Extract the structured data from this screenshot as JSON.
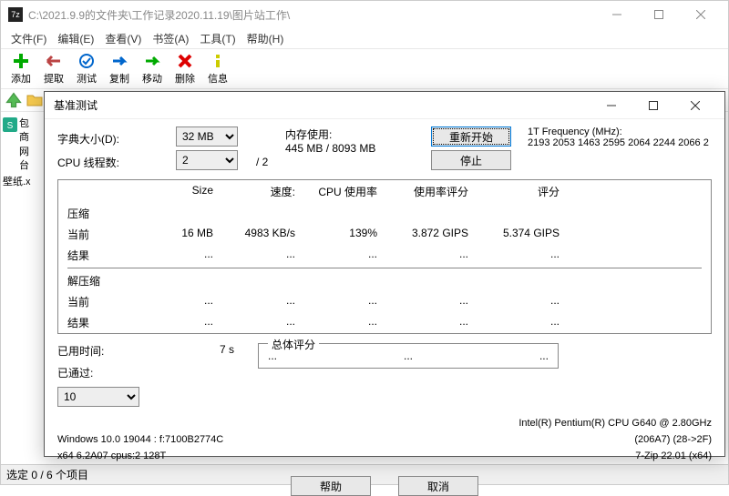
{
  "main": {
    "app_icon_text": "7z",
    "title": "C:\\2021.9.9的文件夹\\工作记录2020.11.19\\图片站工作\\",
    "menubar": [
      "文件(F)",
      "编辑(E)",
      "查看(V)",
      "书签(A)",
      "工具(T)",
      "帮助(H)"
    ],
    "toolbar": {
      "add": "添加",
      "extract": "提取",
      "test": "测试",
      "copy": "复制",
      "move": "移动",
      "delete": "删除",
      "info": "信息"
    },
    "path": "C:\\2021.9.9的文件夹\\工作记录2020.11.19\\图片站工作\\",
    "sidebar": {
      "item0": "包商网台",
      "item1": "壁纸.x"
    },
    "status": "选定 0 / 6 个项目"
  },
  "dialog": {
    "title": "基准测试",
    "dict_label": "字典大小(D):",
    "dict_value": "32 MB",
    "threads_label": "CPU 线程数:",
    "threads_value": "2",
    "threads_total": "/ 2",
    "mem_label": "内存使用:",
    "mem_value": "445 MB / 8093 MB",
    "restart": "重新开始",
    "stop": "停止",
    "freq_label": "1T Frequency (MHz):",
    "freq_values": "2193 2053 1463 2595 2064 2244 2066 2",
    "headers": {
      "size": "Size",
      "speed": "速度:",
      "cpu": "CPU 使用率",
      "rating": "使用率评分",
      "score": "评分"
    },
    "compress": {
      "label": "压缩",
      "current_label": "当前",
      "current": {
        "size": "16 MB",
        "speed": "4983 KB/s",
        "cpu": "139%",
        "rating": "3.872 GIPS",
        "score": "5.374 GIPS"
      },
      "result_label": "结果",
      "result": {
        "size": "...",
        "speed": "...",
        "cpu": "...",
        "rating": "...",
        "score": "..."
      }
    },
    "decompress": {
      "label": "解压缩",
      "current_label": "当前",
      "current": {
        "size": "...",
        "speed": "...",
        "cpu": "...",
        "rating": "...",
        "score": "..."
      },
      "result_label": "结果",
      "result": {
        "size": "...",
        "speed": "...",
        "cpu": "...",
        "rating": "...",
        "score": "..."
      }
    },
    "elapsed_label": "已用时间:",
    "elapsed_value": "7 s",
    "passes_label": "已通过:",
    "passes_select": "10",
    "total_label": "总体评分",
    "total_vals": {
      "a": "...",
      "b": "...",
      "c": "..."
    },
    "cpu_info": "Intel(R) Pentium(R) CPU G640 @ 2.80GHz",
    "cpu_id": "(206A7)  (28->2F)",
    "os_info": "Windows 10.0 19044  : f:7100B2774C",
    "zip_info": "7-Zip 22.01  (x64)",
    "arch_info": "x64 6.2A07 cpus:2 128T",
    "help": "帮助",
    "cancel": "取消"
  }
}
